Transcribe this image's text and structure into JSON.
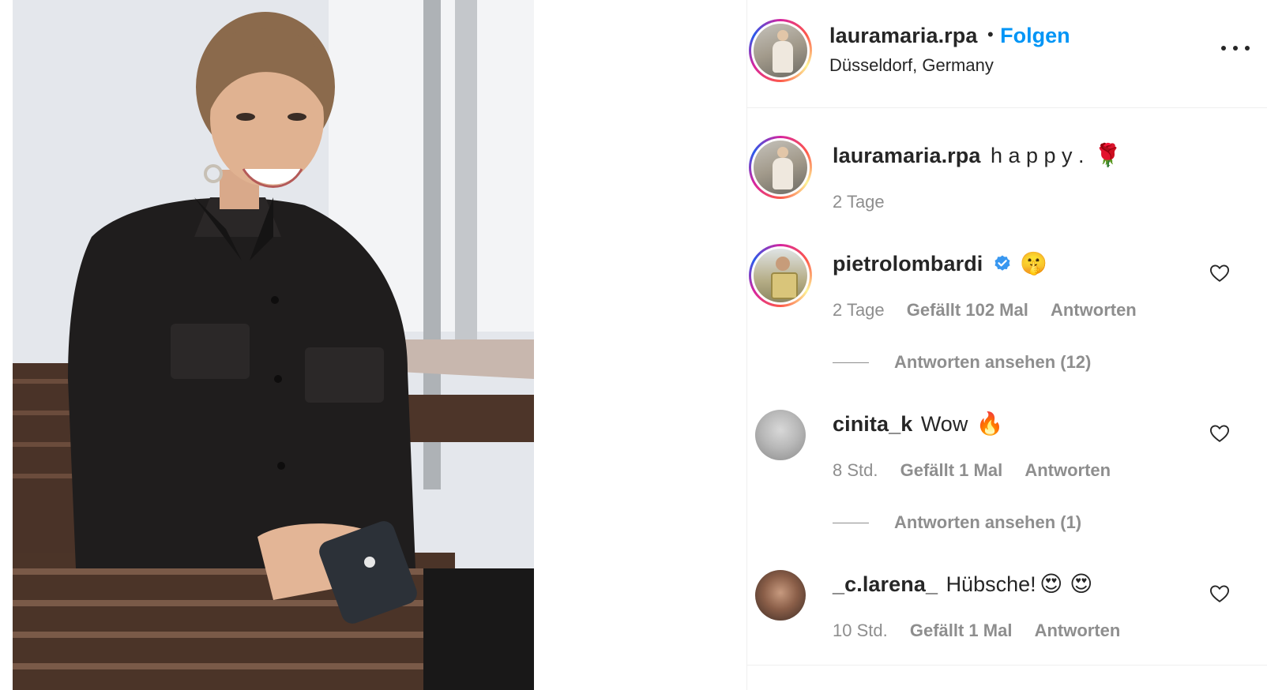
{
  "header": {
    "username": "lauramaria.rpa",
    "separator": "•",
    "follow_label": "Folgen",
    "location": "Düsseldorf, Germany",
    "more_icon": "more-horizontal-icon"
  },
  "caption": {
    "username": "lauramaria.rpa",
    "text": "h a p p y .",
    "emoji": "🌹",
    "time": "2 Tage"
  },
  "comments": [
    {
      "username": "pietrolombardi",
      "verified": true,
      "text": "",
      "emoji": "🤫",
      "time": "2 Tage",
      "likes": "Gefällt 102 Mal",
      "reply_label": "Antworten",
      "view_replies": "Antworten ansehen (12)"
    },
    {
      "username": "cinita_k",
      "verified": false,
      "text": "Wow",
      "emoji": "🔥",
      "time": "8 Std.",
      "likes": "Gefällt 1 Mal",
      "reply_label": "Antworten",
      "view_replies": "Antworten ansehen (1)"
    },
    {
      "username": "_c.larena_",
      "verified": false,
      "text": "Hübsche!",
      "emoji": "😍 😍",
      "time": "10 Std.",
      "likes": "Gefällt 1 Mal",
      "reply_label": "Antworten",
      "view_replies": ""
    }
  ],
  "colors": {
    "accent": "#0095f6",
    "text": "#262626",
    "secondary": "#8e8e8e",
    "border": "#efefef"
  }
}
